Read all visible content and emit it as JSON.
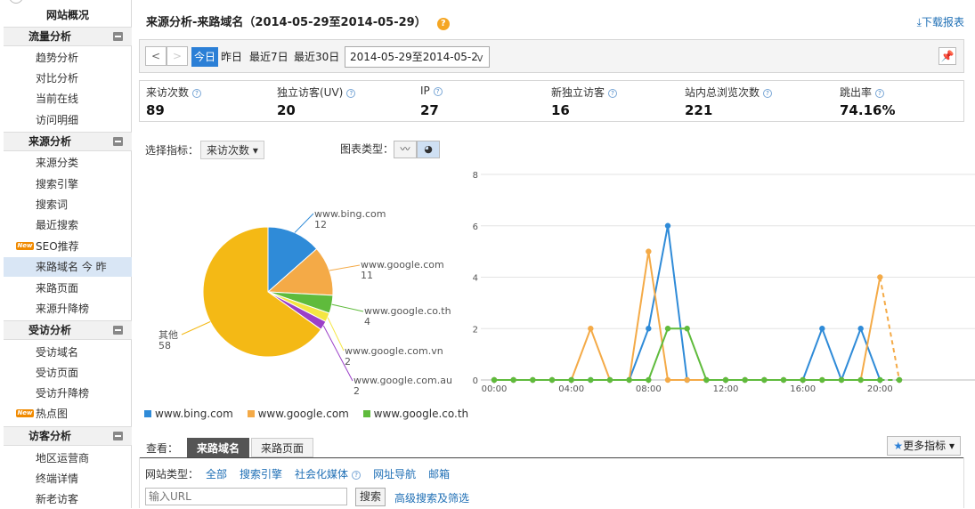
{
  "sidebar": {
    "top": "网站概况",
    "sections": [
      {
        "title": "流量分析",
        "items": [
          "趋势分析",
          "对比分析",
          "当前在线",
          "访问明细"
        ]
      },
      {
        "title": "来源分析",
        "items": [
          "来源分类",
          "搜索引擎",
          "搜索词",
          "最近搜索",
          "SEO推荐",
          "来路域名",
          "来路页面",
          "来源升降榜"
        ]
      },
      {
        "title": "受访分析",
        "items": [
          "受访域名",
          "受访页面",
          "受访升降榜",
          "热点图"
        ]
      },
      {
        "title": "访客分析",
        "items": [
          "地区运营商",
          "终端详情",
          "新老访客"
        ]
      }
    ],
    "new_badge": "New",
    "active_suffix": "今 昨"
  },
  "header": {
    "title": "来源分析-来路域名（2014-05-29至2014-05-29）",
    "help": "?",
    "download": "下载报表"
  },
  "toolbar": {
    "prev": "<",
    "next": ">",
    "ranges": [
      "今日",
      "昨日",
      "最近7日",
      "最近30日"
    ],
    "date_value": "2014-05-29至2014-05-2",
    "dropdown_arrow": "v"
  },
  "metrics": [
    {
      "label": "来访次数",
      "value": "89"
    },
    {
      "label": "独立访客(UV)",
      "value": "20"
    },
    {
      "label": "IP",
      "value": "27"
    },
    {
      "label": "新独立访客",
      "value": "16"
    },
    {
      "label": "站内总浏览次数",
      "value": "221"
    },
    {
      "label": "跳出率",
      "value": "74.16%"
    }
  ],
  "chart_controls": {
    "select_label": "选择指标：",
    "select_value": "来访次数",
    "type_label": "图表类型："
  },
  "chart_data": [
    {
      "type": "pie",
      "slices": [
        {
          "label": "www.bing.com",
          "value": 12,
          "color": "#2f8bd8"
        },
        {
          "label": "www.google.com",
          "value": 11,
          "color": "#f4aa47"
        },
        {
          "label": "www.google.co.th",
          "value": 4,
          "color": "#5fbb3c"
        },
        {
          "label": "www.google.com.vn",
          "value": 2,
          "color": "#f5e642"
        },
        {
          "label": "www.google.com.au",
          "value": 2,
          "color": "#9b3fc8"
        },
        {
          "label": "其他",
          "value": 58,
          "color": "#f4b915"
        }
      ]
    },
    {
      "type": "line",
      "x": [
        "00:00",
        "01:00",
        "02:00",
        "03:00",
        "04:00",
        "05:00",
        "06:00",
        "07:00",
        "08:00",
        "09:00",
        "10:00",
        "11:00",
        "12:00",
        "13:00",
        "14:00",
        "15:00",
        "16:00",
        "17:00",
        "18:00",
        "19:00",
        "20:00",
        "21:00"
      ],
      "xticks": [
        "00:00",
        "04:00",
        "08:00",
        "12:00",
        "16:00",
        "20:00"
      ],
      "ylim": [
        0,
        8
      ],
      "yticks": [
        "0",
        "2",
        "4",
        "6",
        "8"
      ],
      "series": [
        {
          "name": "www.bing.com",
          "color": "#2f8bd8",
          "values": [
            0,
            0,
            0,
            0,
            0,
            0,
            0,
            0,
            2,
            6,
            0,
            0,
            0,
            0,
            0,
            0,
            0,
            2,
            0,
            2,
            0,
            0
          ]
        },
        {
          "name": "www.google.com",
          "color": "#f4aa47",
          "values": [
            0,
            0,
            0,
            0,
            0,
            2,
            0,
            0,
            5,
            0,
            0,
            0,
            0,
            0,
            0,
            0,
            0,
            0,
            0,
            0,
            4,
            0
          ]
        },
        {
          "name": "www.google.co.th",
          "color": "#5fbb3c",
          "values": [
            0,
            0,
            0,
            0,
            0,
            0,
            0,
            0,
            0,
            2,
            2,
            0,
            0,
            0,
            0,
            0,
            0,
            0,
            0,
            0,
            0,
            0
          ]
        }
      ]
    }
  ],
  "legend": [
    "www.bing.com",
    "www.google.com",
    "www.google.co.th"
  ],
  "tabs": {
    "label": "查看：",
    "items": [
      "来路域名",
      "来路页面"
    ],
    "more": "更多指标"
  },
  "filters": {
    "label": "网站类型：",
    "links": [
      "全部",
      "搜索引擎",
      "社会化媒体",
      "网址导航",
      "邮箱"
    ],
    "search_placeholder": "输入URL",
    "search_button": "搜索",
    "advanced": "高级搜索及筛选"
  }
}
